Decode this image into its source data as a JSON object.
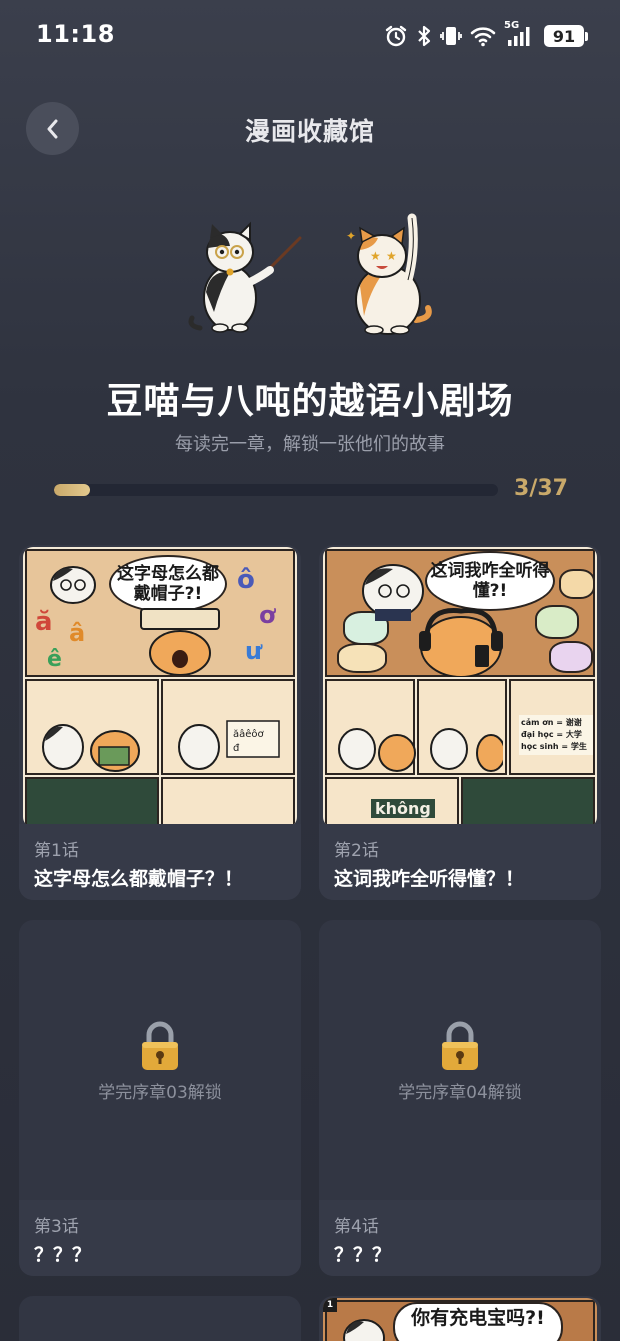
{
  "status_bar": {
    "time": "11:18",
    "network": "5G",
    "battery": "91",
    "icons": [
      "alarm-icon",
      "bluetooth-icon",
      "vibrate-icon",
      "wifi-icon",
      "signal-icon"
    ]
  },
  "header": {
    "back_icon": "chevron-left-icon",
    "title": "漫画收藏馆"
  },
  "hero": {
    "title": "豆喵与八吨的越语小剧场",
    "subtitle": "每读完一章，解锁一张他们的故事"
  },
  "progress": {
    "unlocked": 3,
    "total": 37,
    "label": "3/37",
    "fraction": 0.081,
    "color": "#c9a96a"
  },
  "episodes": [
    {
      "number": "第1话",
      "title": "这字母怎么都戴帽子？！",
      "locked": false,
      "comic_caption": "这字母怎么都戴帽子?!",
      "comic_letters": [
        "ô",
        "ơ",
        "ư",
        "ă",
        "â",
        "ê"
      ]
    },
    {
      "number": "第2话",
      "title": "这词我咋全听得懂？！",
      "locked": false,
      "comic_caption": "这词我咋全听得懂?!",
      "comic_words": [
        "cảm ơn = 谢谢",
        "đại học = 大学",
        "học sinh = 学生",
        "không"
      ]
    },
    {
      "number": "第3话",
      "title": "？？？",
      "locked": true,
      "lock_text": "学完序章03解锁"
    },
    {
      "number": "第4话",
      "title": "？？？",
      "locked": true,
      "lock_text": "学完序章04解锁"
    },
    {
      "number": "",
      "title": "",
      "locked": true
    },
    {
      "number": "",
      "title": "",
      "locked": false,
      "comic_caption": "你有充电宝吗?!"
    }
  ],
  "colors": {
    "background": "#2f333f",
    "card": "#343845",
    "accent_gold": "#c9a96a"
  }
}
